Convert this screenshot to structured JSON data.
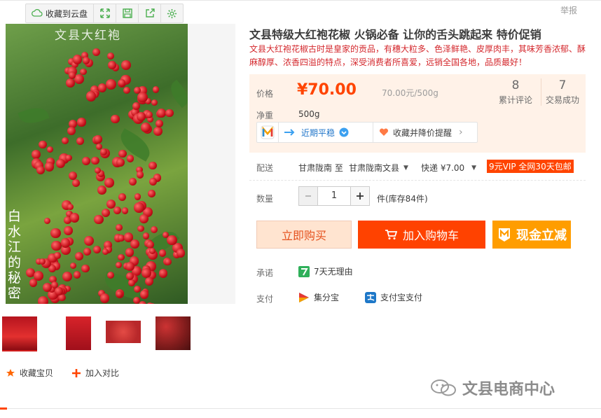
{
  "toolbar": {
    "cloud_label": "收藏到云盘"
  },
  "report_label": "举报",
  "image": {
    "top_caption": "文县大红袍",
    "side_caption": "白水江的秘密"
  },
  "product": {
    "title": "文县特级大红袍花椒 火锅必备 让你的舌头跳起来 特价促销",
    "subtitle": "文县大红袍花椒古时是皇家的贡品，有穗大粒多、色泽鲜艳、皮厚肉丰，其味芳香浓郁、酥麻醇厚、浓香四溢的特点，深受消费者所喜爱，远销全国各地，品质最好！"
  },
  "price": {
    "label": "价格",
    "current": "¥70.00",
    "unit_price": "70.00元/500g",
    "weight_label": "净重",
    "weight_value": "500g"
  },
  "stats": {
    "reviews_count": "8",
    "reviews_label": "累计评论",
    "deals_count": "7",
    "deals_label": "交易成功"
  },
  "promo": {
    "trend_label": "近期平稳",
    "collect_label": "收藏并降价提醒"
  },
  "shipping": {
    "label": "配送",
    "from": "甘肃陇南 至",
    "to": "甘肃陇南文县",
    "method": "快递 ¥7.00",
    "vip_badge": "9元VIP 全网30天包邮"
  },
  "quantity": {
    "label": "数量",
    "value": "1",
    "stock": "件(库存84件)"
  },
  "buttons": {
    "buy_now": "立即购买",
    "add_cart": "加入购物车",
    "cash": "现金立减"
  },
  "promise": {
    "label": "承诺",
    "text": "7天无理由"
  },
  "payment": {
    "label": "支付",
    "method1": "集分宝",
    "method2": "支付宝支付"
  },
  "actions": {
    "favorite": "收藏宝贝",
    "compare": "加入对比"
  },
  "watermark": "文县电商中心",
  "colors": {
    "accent": "#ff4400",
    "cart": "#ff4200",
    "cash": "#ff9d00",
    "price_bg": "#fff2e8"
  }
}
